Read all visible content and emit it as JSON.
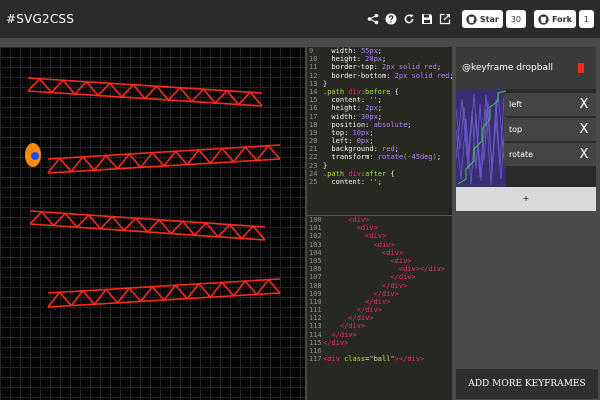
{
  "app": {
    "title": "#SVG2CSS"
  },
  "toolbar": {
    "icons": [
      "share-icon",
      "help-icon",
      "refresh-icon",
      "save-icon",
      "external-edit-icon"
    ],
    "star_label": "Star",
    "star_count": "30",
    "fork_label": "Fork",
    "fork_count": "1"
  },
  "stage": {
    "colors": {
      "background": "#050505",
      "path": "#ff2a1a",
      "ball_outer": "#ff8a00",
      "ball_inner": "#1a4cff"
    }
  },
  "code_css": [
    {
      "n": "9",
      "t": [
        [
          "tok-prop",
          "  width: "
        ],
        [
          "tok-val",
          "55px"
        ],
        [
          "tok-prop",
          ";"
        ]
      ]
    },
    {
      "n": "10",
      "t": [
        [
          "tok-prop",
          "  height: "
        ],
        [
          "tok-val",
          "20px"
        ],
        [
          "tok-prop",
          ";"
        ]
      ]
    },
    {
      "n": "11",
      "t": [
        [
          "tok-prop",
          "  border-top: "
        ],
        [
          "tok-val",
          "2px solid red"
        ],
        [
          "tok-prop",
          ";"
        ]
      ]
    },
    {
      "n": "12",
      "t": [
        [
          "tok-prop",
          "  border-bottom: "
        ],
        [
          "tok-val",
          "2px solid red"
        ],
        [
          "tok-prop",
          ";"
        ]
      ]
    },
    {
      "n": "13",
      "t": [
        [
          "tok-txt",
          "}"
        ]
      ]
    },
    {
      "n": "14",
      "t": [
        [
          "tok-sel",
          ".path "
        ],
        [
          "tok-kw",
          "div"
        ],
        [
          "tok-sel",
          ":before"
        ],
        [
          "tok-txt",
          " {"
        ]
      ]
    },
    {
      "n": "15",
      "t": [
        [
          "tok-prop",
          "  content: "
        ],
        [
          "tok-str",
          "''"
        ],
        [
          "tok-prop",
          ";"
        ]
      ]
    },
    {
      "n": "16",
      "t": [
        [
          "tok-prop",
          "  height: "
        ],
        [
          "tok-val",
          "2px"
        ],
        [
          "tok-prop",
          ";"
        ]
      ]
    },
    {
      "n": "17",
      "t": [
        [
          "tok-prop",
          "  width: "
        ],
        [
          "tok-val",
          "30px"
        ],
        [
          "tok-prop",
          ";"
        ]
      ]
    },
    {
      "n": "18",
      "t": [
        [
          "tok-prop",
          "  position: "
        ],
        [
          "tok-val",
          "absolute"
        ],
        [
          "tok-prop",
          ";"
        ]
      ]
    },
    {
      "n": "19",
      "t": [
        [
          "tok-prop",
          "  top: "
        ],
        [
          "tok-val",
          "10px"
        ],
        [
          "tok-prop",
          ";"
        ]
      ]
    },
    {
      "n": "20",
      "t": [
        [
          "tok-prop",
          "  left: "
        ],
        [
          "tok-val",
          "0px"
        ],
        [
          "tok-prop",
          ";"
        ]
      ]
    },
    {
      "n": "21",
      "t": [
        [
          "tok-prop",
          "  background: "
        ],
        [
          "tok-val",
          "red"
        ],
        [
          "tok-prop",
          ";"
        ]
      ]
    },
    {
      "n": "22",
      "t": [
        [
          "tok-prop",
          "  transform: "
        ],
        [
          "tok-val",
          "rotate(-45deg)"
        ],
        [
          "tok-prop",
          ";"
        ]
      ]
    },
    {
      "n": "23",
      "t": [
        [
          "tok-txt",
          "}"
        ]
      ]
    },
    {
      "n": "24",
      "t": [
        [
          "tok-sel",
          ".path "
        ],
        [
          "tok-kw",
          "div"
        ],
        [
          "tok-sel",
          ":after"
        ],
        [
          "tok-txt",
          " {"
        ]
      ]
    },
    {
      "n": "25",
      "t": [
        [
          "tok-prop",
          "  content: "
        ],
        [
          "tok-str",
          "'';"
        ]
      ]
    }
  ],
  "code_html": [
    {
      "n": "100",
      "t": [
        [
          "tok-txt",
          "      "
        ],
        [
          "tok-tag",
          "<div>"
        ]
      ]
    },
    {
      "n": "101",
      "t": [
        [
          "tok-txt",
          "        "
        ],
        [
          "tok-tag",
          "<div>"
        ]
      ]
    },
    {
      "n": "102",
      "t": [
        [
          "tok-txt",
          "          "
        ],
        [
          "tok-tag",
          "<div>"
        ]
      ]
    },
    {
      "n": "103",
      "t": [
        [
          "tok-txt",
          "            "
        ],
        [
          "tok-tag",
          "<div>"
        ]
      ]
    },
    {
      "n": "104",
      "t": [
        [
          "tok-txt",
          "              "
        ],
        [
          "tok-tag",
          "<div>"
        ]
      ]
    },
    {
      "n": "105",
      "t": [
        [
          "tok-txt",
          "                "
        ],
        [
          "tok-tag",
          "<div>"
        ]
      ]
    },
    {
      "n": "106",
      "t": [
        [
          "tok-txt",
          "                  "
        ],
        [
          "tok-tag",
          "<div></div>"
        ]
      ]
    },
    {
      "n": "107",
      "t": [
        [
          "tok-txt",
          "                "
        ],
        [
          "tok-tag",
          "</div>"
        ]
      ]
    },
    {
      "n": "108",
      "t": [
        [
          "tok-txt",
          "              "
        ],
        [
          "tok-tag",
          "</div>"
        ]
      ]
    },
    {
      "n": "109",
      "t": [
        [
          "tok-txt",
          "            "
        ],
        [
          "tok-tag",
          "</div>"
        ]
      ]
    },
    {
      "n": "110",
      "t": [
        [
          "tok-txt",
          "          "
        ],
        [
          "tok-tag",
          "</div>"
        ]
      ]
    },
    {
      "n": "111",
      "t": [
        [
          "tok-txt",
          "        "
        ],
        [
          "tok-tag",
          "</div>"
        ]
      ]
    },
    {
      "n": "112",
      "t": [
        [
          "tok-txt",
          "      "
        ],
        [
          "tok-tag",
          "</div>"
        ]
      ]
    },
    {
      "n": "113",
      "t": [
        [
          "tok-txt",
          "    "
        ],
        [
          "tok-tag",
          "</div>"
        ]
      ]
    },
    {
      "n": "114",
      "t": [
        [
          "tok-txt",
          "  "
        ],
        [
          "tok-tag",
          "</div>"
        ]
      ]
    },
    {
      "n": "115",
      "t": [
        [
          "tok-tag",
          "</div>"
        ]
      ]
    },
    {
      "n": "116",
      "t": []
    },
    {
      "n": "117",
      "t": [
        [
          "tok-tag",
          "<div "
        ],
        [
          "tok-attr",
          "class"
        ],
        [
          "tok-txt",
          "="
        ],
        [
          "tok-str",
          "\"ball\""
        ],
        [
          "tok-tag",
          "></div>"
        ]
      ]
    }
  ],
  "keyframes": {
    "title": "@keyframe dropball",
    "color": "#ff2a1a",
    "props": [
      "left",
      "top",
      "rotate"
    ],
    "remove_glyph": "X",
    "add_label": "+",
    "more_label": "ADD MORE KEYFRAMES"
  }
}
